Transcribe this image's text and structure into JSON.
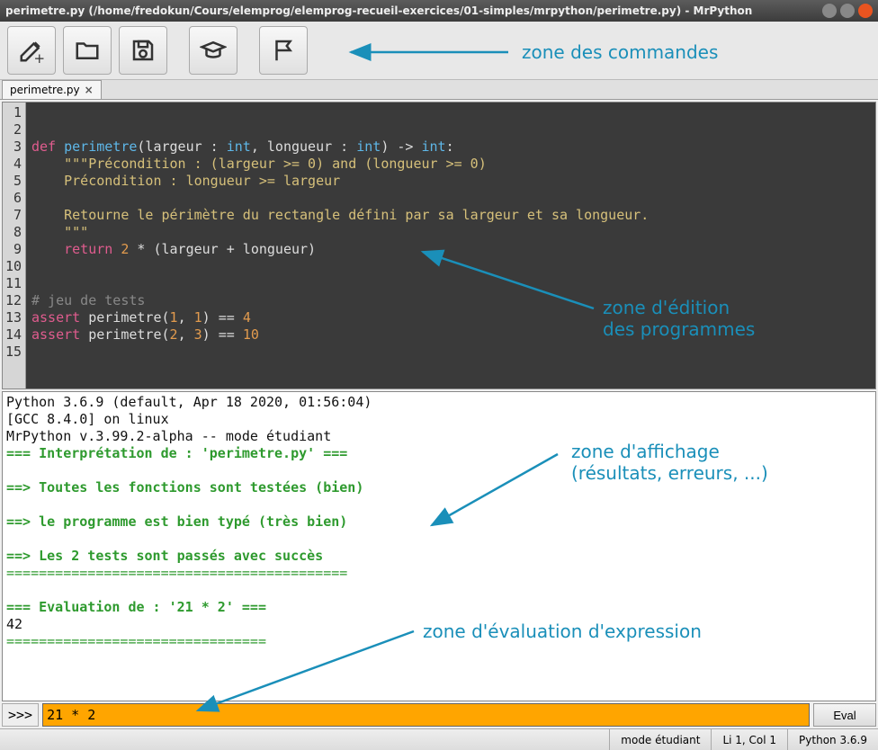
{
  "window": {
    "title": "perimetre.py (/home/fredokun/Cours/elemprog/elemprog-recueil-exercices/01-simples/mrpython/perimetre.py) - MrPython"
  },
  "toolbar": {
    "icons": {
      "new": "pencil-plus-icon",
      "open": "folder-icon",
      "save": "floppy-icon",
      "student": "graduation-cap-icon",
      "run": "flag-icon"
    }
  },
  "tab": {
    "label": "perimetre.py",
    "close": "×"
  },
  "editor": {
    "line_count": 15,
    "tokens": [
      [],
      [],
      [
        {
          "c": "tok-kw",
          "t": "def "
        },
        {
          "c": "tok-name",
          "t": "perimetre"
        },
        {
          "c": "tok-plain",
          "t": "(largeur : "
        },
        {
          "c": "tok-type",
          "t": "int"
        },
        {
          "c": "tok-plain",
          "t": ", longueur : "
        },
        {
          "c": "tok-type",
          "t": "int"
        },
        {
          "c": "tok-plain",
          "t": ") -> "
        },
        {
          "c": "tok-type",
          "t": "int"
        },
        {
          "c": "tok-plain",
          "t": ":"
        }
      ],
      [
        {
          "c": "tok-plain",
          "t": "    "
        },
        {
          "c": "tok-str",
          "t": "\"\"\"Précondition : (largeur >= 0) and (longueur >= 0)"
        }
      ],
      [
        {
          "c": "tok-str",
          "t": "    Précondition : longueur >= largeur"
        }
      ],
      [],
      [
        {
          "c": "tok-str",
          "t": "    Retourne le périmètre du rectangle défini par sa largeur et sa longueur."
        }
      ],
      [
        {
          "c": "tok-str",
          "t": "    \"\"\""
        }
      ],
      [
        {
          "c": "tok-plain",
          "t": "    "
        },
        {
          "c": "tok-kw",
          "t": "return"
        },
        {
          "c": "tok-plain",
          "t": " "
        },
        {
          "c": "tok-num",
          "t": "2"
        },
        {
          "c": "tok-plain",
          "t": " * (largeur + longueur)"
        }
      ],
      [],
      [],
      [
        {
          "c": "tok-comment",
          "t": "# jeu de tests"
        }
      ],
      [
        {
          "c": "tok-assert",
          "t": "assert"
        },
        {
          "c": "tok-plain",
          "t": " perimetre("
        },
        {
          "c": "tok-num",
          "t": "1"
        },
        {
          "c": "tok-plain",
          "t": ", "
        },
        {
          "c": "tok-num",
          "t": "1"
        },
        {
          "c": "tok-plain",
          "t": ") == "
        },
        {
          "c": "tok-num",
          "t": "4"
        }
      ],
      [
        {
          "c": "tok-assert",
          "t": "assert"
        },
        {
          "c": "tok-plain",
          "t": " perimetre("
        },
        {
          "c": "tok-num",
          "t": "2"
        },
        {
          "c": "tok-plain",
          "t": ", "
        },
        {
          "c": "tok-num",
          "t": "3"
        },
        {
          "c": "tok-plain",
          "t": ") == "
        },
        {
          "c": "tok-num",
          "t": "10"
        }
      ],
      []
    ]
  },
  "output": {
    "lines": [
      {
        "c": "",
        "t": "Python 3.6.9 (default, Apr 18 2020, 01:56:04)"
      },
      {
        "c": "",
        "t": "[GCC 8.4.0] on linux"
      },
      {
        "c": "",
        "t": "MrPython v.3.99.2-alpha -- mode étudiant"
      },
      {
        "c": "out-green out-bold",
        "t": "=== Interprétation de : 'perimetre.py' ==="
      },
      {
        "c": "",
        "t": ""
      },
      {
        "c": "out-green out-bold",
        "t": "==> Toutes les fonctions sont testées (bien)"
      },
      {
        "c": "",
        "t": ""
      },
      {
        "c": "out-green out-bold",
        "t": "==> le programme est bien typé (très bien)"
      },
      {
        "c": "",
        "t": ""
      },
      {
        "c": "out-green out-bold",
        "t": "==> Les 2 tests sont passés avec succès"
      },
      {
        "c": "out-green",
        "t": "=========================================="
      },
      {
        "c": "",
        "t": ""
      },
      {
        "c": "out-green out-bold",
        "t": "=== Evaluation de : '21 * 2' ==="
      },
      {
        "c": "",
        "t": "42"
      },
      {
        "c": "out-green",
        "t": "================================"
      }
    ]
  },
  "eval": {
    "prompt": ">>>",
    "value": "21 * 2",
    "button": "Eval"
  },
  "status": {
    "mode": "mode étudiant",
    "cursor": "Li 1, Col 1",
    "python": "Python 3.6.9"
  },
  "annotations": {
    "commands": "zone des commandes",
    "editor": "zone d'édition",
    "editor2": "des programmes",
    "output": "zone d'affichage",
    "output2": "(résultats, erreurs, ...)",
    "eval": "zone d'évaluation d'expression"
  }
}
